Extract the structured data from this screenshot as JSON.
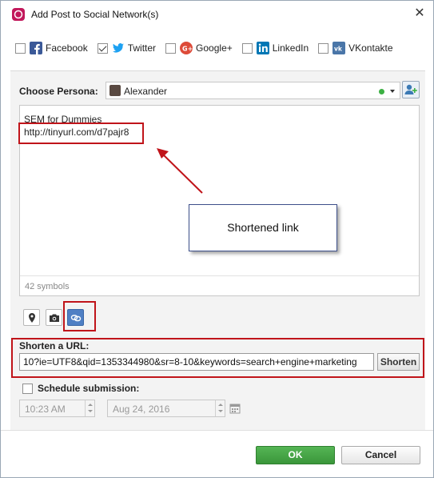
{
  "window": {
    "title": "Add Post to Social Network(s)",
    "accent": "#c2185b"
  },
  "networks": [
    {
      "label": "Facebook",
      "checked": false,
      "icon": "facebook-icon",
      "color": "#3b5998"
    },
    {
      "label": "Twitter",
      "checked": true,
      "icon": "twitter-icon",
      "color": "#1da1f2"
    },
    {
      "label": "Google+",
      "checked": false,
      "icon": "googleplus-icon",
      "color": "#dd4b39"
    },
    {
      "label": "LinkedIn",
      "checked": false,
      "icon": "linkedin-icon",
      "color": "#0077b5"
    },
    {
      "label": "VKontakte",
      "checked": false,
      "icon": "vk-icon",
      "color": "#4a76a8"
    }
  ],
  "persona": {
    "label": "Choose Persona:",
    "value": "Alexander",
    "status_color": "#3cb043"
  },
  "post": {
    "line1": "SEM for Dummies",
    "line2": "http://tinyurl.com/d7pajr8",
    "counter": "42 symbols"
  },
  "annotation": {
    "callout": "Shortened link",
    "highlight_color": "#c0141a"
  },
  "tools": [
    {
      "icon": "location-pin-icon",
      "active": false
    },
    {
      "icon": "camera-icon",
      "active": false
    },
    {
      "icon": "link-shorten-icon",
      "active": true
    }
  ],
  "shorten": {
    "label": "Shorten a URL:",
    "value": "10?ie=UTF8&qid=1353344980&sr=8-10&keywords=search+engine+marketing",
    "button": "Shorten"
  },
  "schedule": {
    "label": "Schedule submission:",
    "checked": false,
    "time": "10:23 AM",
    "date": "Aug 24, 2016"
  },
  "buttons": {
    "ok": "OK",
    "cancel": "Cancel",
    "ok_color": "#3a963a"
  }
}
